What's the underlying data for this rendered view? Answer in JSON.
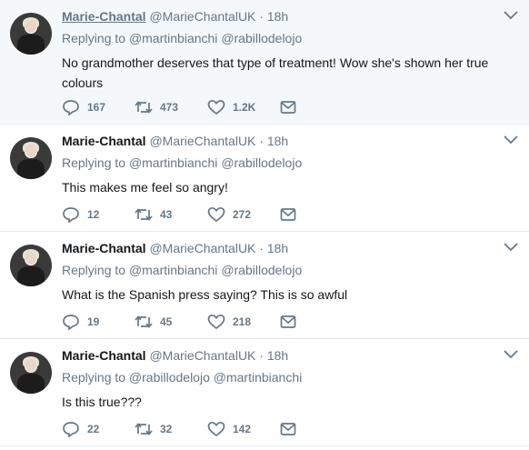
{
  "tweets": [
    {
      "name": "Marie-Chantal",
      "handle": "@MarieChantalUK",
      "dot": "·",
      "time": "18h",
      "replying_prefix": "Replying to",
      "mention_1": "@martinbianchi",
      "mention_2": "@rabillodelojo",
      "text": "No grandmother deserves that type of treatment! Wow she's shown her true colours",
      "replies": "167",
      "retweets": "473",
      "likes": "1.2K"
    },
    {
      "name": "Marie-Chantal",
      "handle": "@MarieChantalUK",
      "dot": "·",
      "time": "18h",
      "replying_prefix": "Replying to",
      "mention_1": "@martinbianchi",
      "mention_2": "@rabillodelojo",
      "text": "This makes me feel so angry!",
      "replies": "12",
      "retweets": "43",
      "likes": "272"
    },
    {
      "name": "Marie-Chantal",
      "handle": "@MarieChantalUK",
      "dot": "·",
      "time": "18h",
      "replying_prefix": "Replying to",
      "mention_1": "@martinbianchi",
      "mention_2": "@rabillodelojo",
      "text": "What is the Spanish press saying? This is so awful",
      "replies": "19",
      "retweets": "45",
      "likes": "218"
    },
    {
      "name": "Marie-Chantal",
      "handle": "@MarieChantalUK",
      "dot": "·",
      "time": "18h",
      "replying_prefix": "Replying to",
      "mention_1": "@rabillodelojo",
      "mention_2": "@martinbianchi",
      "text": "Is this true???",
      "replies": "22",
      "retweets": "32",
      "likes": "142"
    }
  ],
  "icons": {
    "reply": "reply-icon",
    "retweet": "retweet-icon",
    "like": "heart-icon",
    "dm": "envelope-icon",
    "menu": "chevron-down-icon"
  },
  "colors": {
    "text": "#14171a",
    "secondary": "#657786",
    "highlight_bg": "#f5f8fa",
    "divider": "#e6ecf0"
  }
}
